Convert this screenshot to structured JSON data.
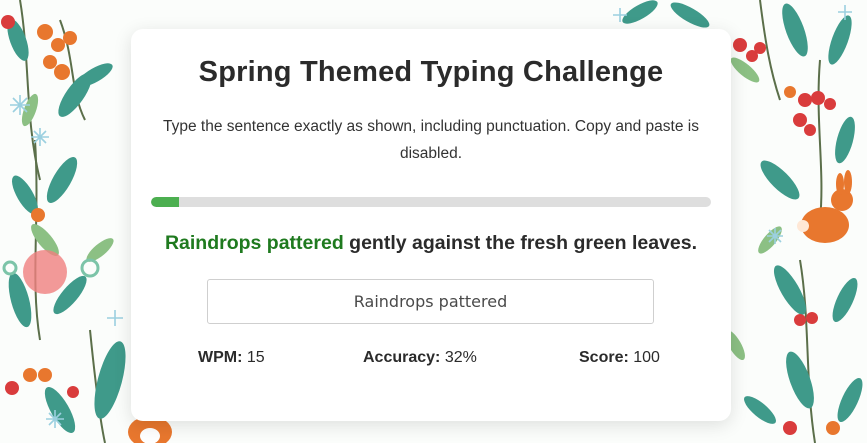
{
  "title": "Spring Themed Typing Challenge",
  "instructions": "Type the sentence exactly as shown, including punctuation. Copy and paste is disabled.",
  "progress": {
    "fraction": 0.05
  },
  "sentence": {
    "typed": "Raindrops pattered",
    "remaining": " gently against the fresh green leaves."
  },
  "input": {
    "value": "Raindrops pattered"
  },
  "stats": {
    "wpm_label": "WPM:",
    "wpm_value": "15",
    "accuracy_label": "Accuracy:",
    "accuracy_value": "32%",
    "score_label": "Score:",
    "score_value": "100"
  },
  "colors": {
    "progress_fill": "#4caf50",
    "typed_text": "#1f7a1f",
    "progress_track": "#dedede"
  },
  "decoration_icons": [
    "leaf-icon",
    "berry-icon",
    "snowflake-icon",
    "flower-icon",
    "rabbit-icon",
    "fox-icon"
  ]
}
